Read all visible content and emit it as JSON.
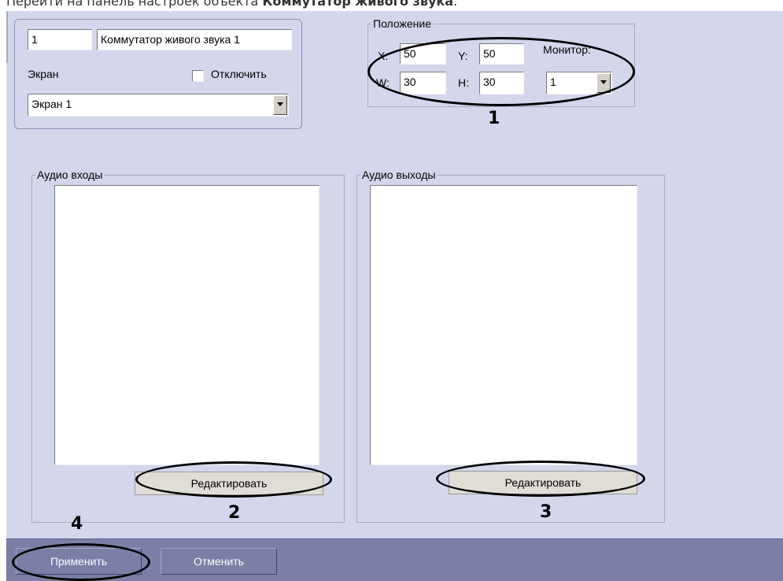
{
  "caption": {
    "prefix": "Перейти на панель настроек объекта ",
    "object_name": "Коммутатор живого звука",
    "suffix": "."
  },
  "object": {
    "id_value": "1",
    "name_value": "Коммутатор живого звука 1",
    "screen_label": "Экран",
    "disable_label": "Отключить",
    "disable_checked": false,
    "screen_select_value": "Экран 1"
  },
  "position": {
    "title": "Положение",
    "x_label": "X:",
    "x_value": "50",
    "y_label": "Y:",
    "y_value": "50",
    "w_label": "W:",
    "w_value": "30",
    "h_label": "H:",
    "h_value": "30",
    "monitor_label": "Монитор:",
    "monitor_value": "1"
  },
  "audio_inputs": {
    "title": "Аудио входы",
    "items": [],
    "edit_label": "Редактировать"
  },
  "audio_outputs": {
    "title": "Аудио выходы",
    "items": [],
    "edit_label": "Редактировать"
  },
  "annotations": {
    "n1": "1",
    "n2": "2",
    "n3": "3",
    "n4": "4"
  },
  "footer": {
    "apply_label": "Применить",
    "cancel_label": "Отменить"
  }
}
